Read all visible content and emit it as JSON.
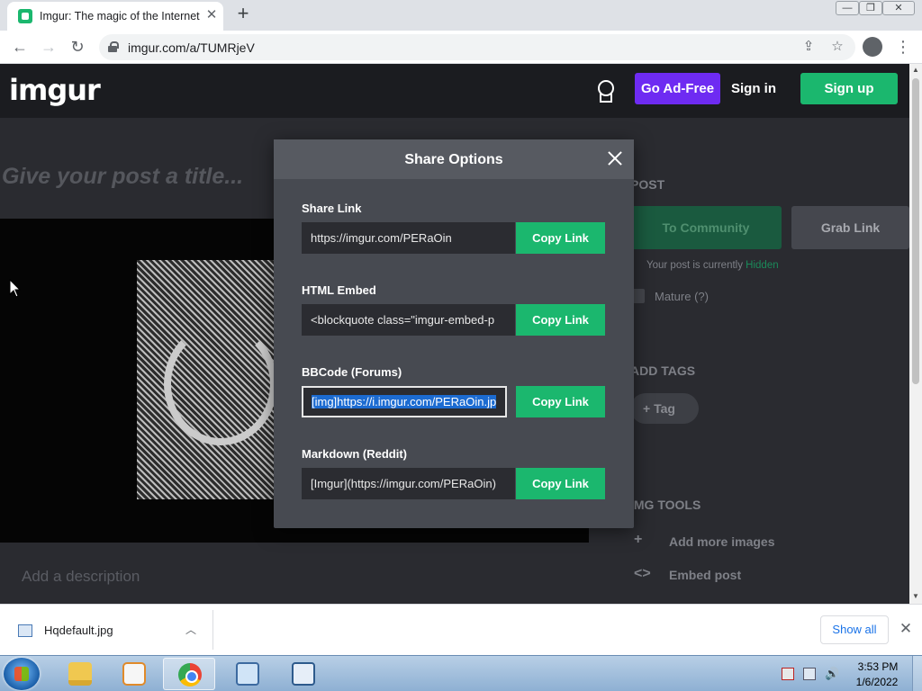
{
  "browser": {
    "tab_title": "Imgur: The magic of the Internet",
    "tab_close": "✕",
    "new_tab": "+",
    "url": "imgur.com/a/TUMRjeV",
    "window_controls": [
      "minimize",
      "restore",
      "close"
    ]
  },
  "header": {
    "logo": "imgur",
    "go_adfree": "Go Ad-Free",
    "sign_in": "Sign in",
    "sign_up": "Sign up"
  },
  "post": {
    "title_placeholder": "Give your post a title...",
    "description_placeholder": "Add a description"
  },
  "sidebar": {
    "post_heading": "POST",
    "to_community": "To Community",
    "grab_link": "Grab Link",
    "status_prefix": "Your post is currently",
    "status_value": "Hidden",
    "mature_label": "Mature (?)",
    "tags_heading": "ADD TAGS",
    "tag_button": "Tag",
    "tools_heading": "IMG TOOLS",
    "tools": [
      {
        "icon": "plus-icon",
        "label": "Add more images"
      },
      {
        "icon": "code-icon",
        "label": "Embed post"
      }
    ]
  },
  "modal": {
    "title": "Share Options",
    "fields": [
      {
        "label": "Share Link",
        "value": "https://imgur.com/PERaOin",
        "button": "Copy Link"
      },
      {
        "label": "HTML Embed",
        "value": "<blockquote class=\"imgur-embed-p",
        "button": "Copy Link"
      },
      {
        "label": "BBCode (Forums)",
        "value": "[img]https://i.imgur.com/PERaOin.jp",
        "button": "Copy Link",
        "selected": true
      },
      {
        "label": "Markdown (Reddit)",
        "value": "[Imgur](https://imgur.com/PERaOin)",
        "button": "Copy Link"
      }
    ]
  },
  "downloads": {
    "file_name": "Hqdefault.jpg",
    "show_all": "Show all"
  },
  "taskbar": {
    "time": "3:53 PM",
    "date": "1/6/2022"
  },
  "colors": {
    "imgur_green": "#1bb76e",
    "adfree_purple": "#6e2bf2",
    "modal_bg": "#474a51",
    "selection_blue": "#1c6bd1"
  }
}
